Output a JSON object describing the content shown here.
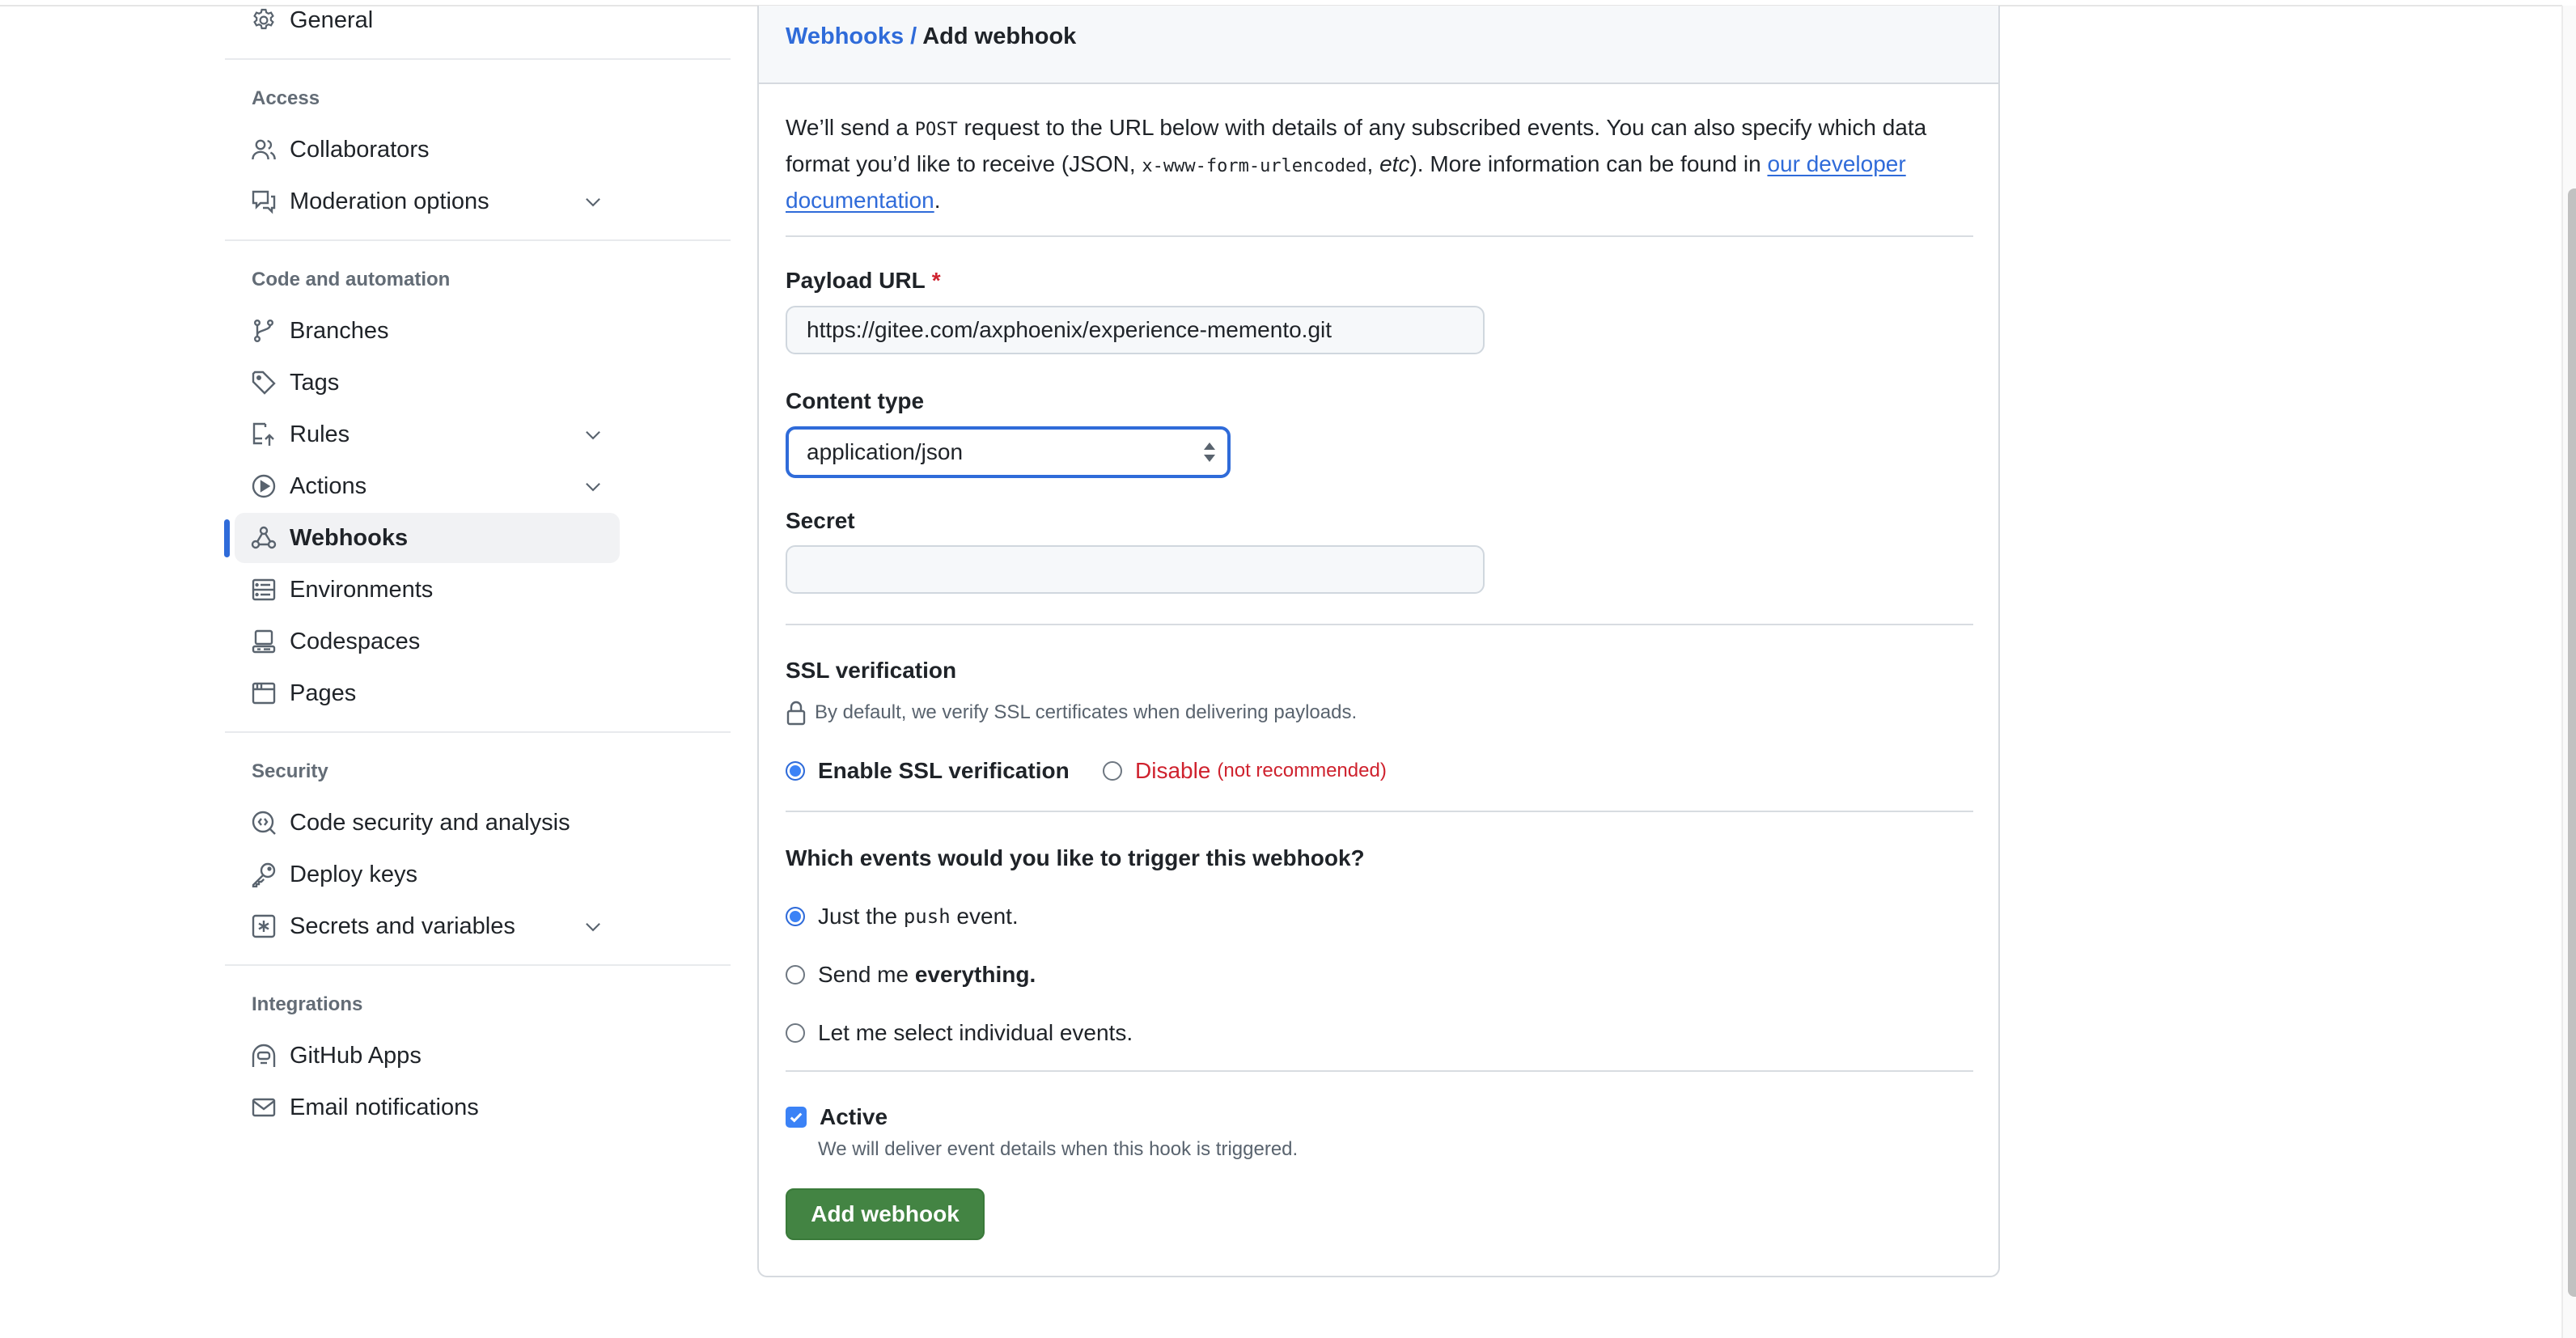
{
  "sidebar": {
    "top_item": {
      "label": "General",
      "icon": "gear-icon"
    },
    "sections": [
      {
        "heading": "Access",
        "items": [
          {
            "label": "Collaborators",
            "icon": "people-icon",
            "expandable": false
          },
          {
            "label": "Moderation options",
            "icon": "comment-discussion-icon",
            "expandable": true
          }
        ]
      },
      {
        "heading": "Code and automation",
        "items": [
          {
            "label": "Branches",
            "icon": "git-branch-icon",
            "expandable": false
          },
          {
            "label": "Tags",
            "icon": "tag-icon",
            "expandable": false
          },
          {
            "label": "Rules",
            "icon": "repo-push-icon",
            "expandable": true
          },
          {
            "label": "Actions",
            "icon": "play-icon",
            "expandable": true
          },
          {
            "label": "Webhooks",
            "icon": "webhook-icon",
            "expandable": false,
            "active": true
          },
          {
            "label": "Environments",
            "icon": "server-icon",
            "expandable": false
          },
          {
            "label": "Codespaces",
            "icon": "codespaces-icon",
            "expandable": false
          },
          {
            "label": "Pages",
            "icon": "browser-icon",
            "expandable": false
          }
        ]
      },
      {
        "heading": "Security",
        "items": [
          {
            "label": "Code security and analysis",
            "icon": "codescan-icon",
            "expandable": false
          },
          {
            "label": "Deploy keys",
            "icon": "key-icon",
            "expandable": false
          },
          {
            "label": "Secrets and variables",
            "icon": "key-asterisk-icon",
            "expandable": true
          }
        ]
      },
      {
        "heading": "Integrations",
        "items": [
          {
            "label": "GitHub Apps",
            "icon": "apps-icon",
            "expandable": false
          },
          {
            "label": "Email notifications",
            "icon": "mail-icon",
            "expandable": false
          }
        ]
      }
    ]
  },
  "header": {
    "breadcrumb_link": "Webhooks",
    "breadcrumb_sep": "/",
    "breadcrumb_current": "Add webhook"
  },
  "description": {
    "part1": "We’ll send a ",
    "code1": "POST",
    "part2": " request to the URL below with details of any subscribed events. You can also specify which data format you’d like to receive (JSON, ",
    "code2": "x-www-form-urlencoded",
    "part3": ", ",
    "italic": "etc",
    "part4": "). More information can be found in ",
    "link": "our developer documentation",
    "part5": "."
  },
  "form": {
    "payload_url": {
      "label": "Payload URL",
      "required_mark": "*",
      "value": "https://gitee.com/axphoenix/experience-memento.git"
    },
    "content_type": {
      "label": "Content type",
      "selected": "application/json"
    },
    "secret": {
      "label": "Secret",
      "value": ""
    },
    "ssl": {
      "label": "SSL verification",
      "hint": "By default, we verify SSL certificates when delivering payloads.",
      "enable_label": "Enable SSL verification",
      "disable_label": "Disable",
      "disable_note": "(not recommended)",
      "selected": "enable"
    },
    "events": {
      "question": "Which events would you like to trigger this webhook?",
      "options": [
        {
          "pre": "Just the ",
          "code": "push",
          "post": " event.",
          "selected": true
        },
        {
          "pre": "Send me ",
          "bold": "everything",
          "post": ".",
          "selected": false
        },
        {
          "pre": "Let me select individual events.",
          "selected": false
        }
      ]
    },
    "active": {
      "label": "Active",
      "checked": true,
      "hint": "We will deliver event details when this hook is triggered."
    },
    "submit_label": "Add webhook"
  },
  "colors": {
    "accent": "#2f6bd9",
    "primary_button": "#438443",
    "danger": "#cf222e"
  }
}
